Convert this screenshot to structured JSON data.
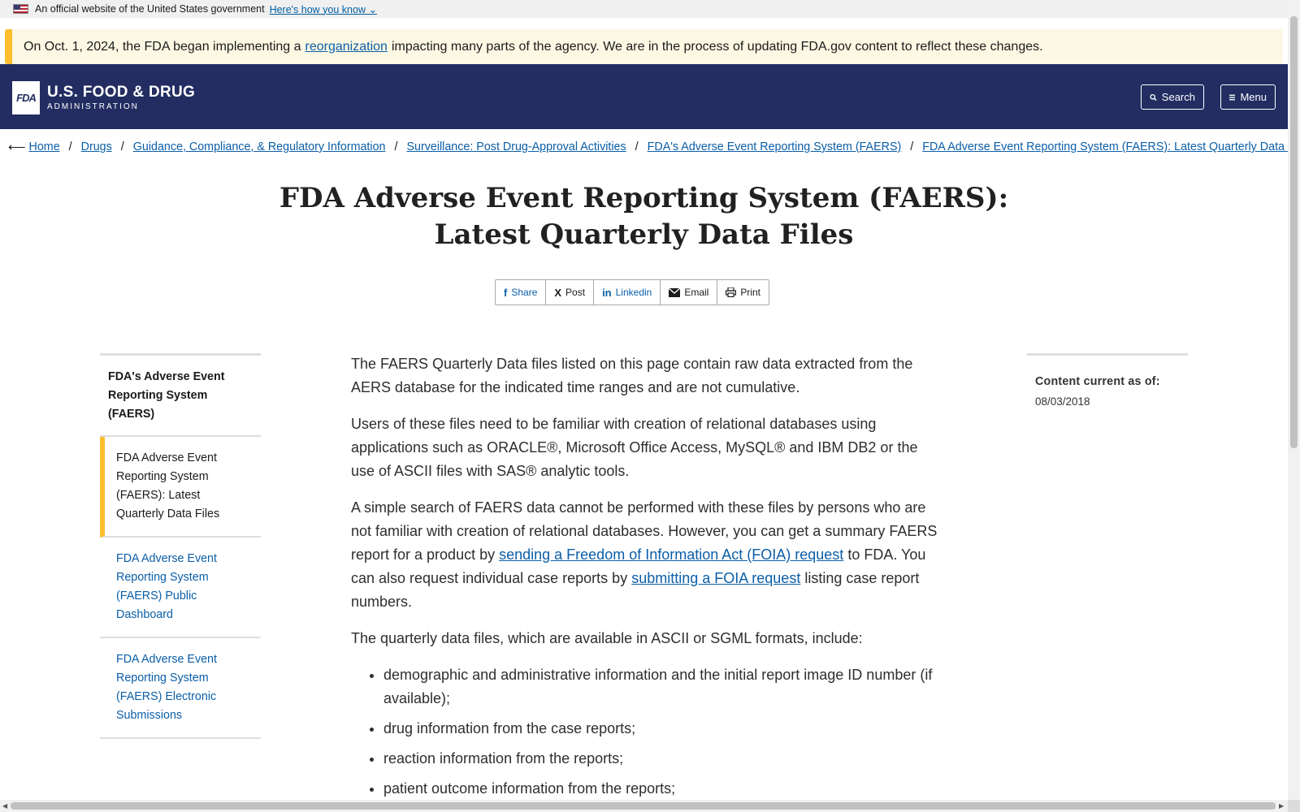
{
  "gov_banner": {
    "text": "An official website of the United States government",
    "link": "Here's how you know"
  },
  "alert": {
    "before": "On Oct. 1, 2024, the FDA began implementing a",
    "link": "reorganization",
    "after": "impacting many parts of the agency. We are in the process of updating FDA.gov content to reflect these changes."
  },
  "header": {
    "logo_box": "FDA",
    "logo_main": "U.S. FOOD & DRUG",
    "logo_sub": "ADMINISTRATION",
    "search_label": "Search",
    "menu_label": "Menu"
  },
  "breadcrumb": [
    "Home",
    "Drugs",
    "Guidance, Compliance, & Regulatory Information",
    "Surveillance: Post Drug-Approval Activities",
    "FDA's Adverse Event Reporting System (FAERS)",
    "FDA Adverse Event Reporting System (FAERS): Latest Quarterly Data Files"
  ],
  "title": {
    "line1": "FDA Adverse Event Reporting System (FAERS):",
    "line2": "Latest Quarterly Data Files"
  },
  "share": {
    "share": "Share",
    "post": "Post",
    "linkedin": "Linkedin",
    "email": "Email",
    "print": "Print"
  },
  "sidenav": {
    "heading": "FDA's Adverse Event Reporting System (FAERS)",
    "items": [
      "FDA Adverse Event Reporting System (FAERS): Latest Quarterly Data Files",
      "FDA Adverse Event Reporting System (FAERS) Public Dashboard",
      "FDA Adverse Event Reporting System (FAERS) Electronic Submissions"
    ]
  },
  "content": {
    "p1": "The FAERS Quarterly Data files listed on this page contain raw data extracted from the AERS database for the indicated time ranges and are not cumulative.",
    "p2": "Users of these files need to be familiar with creation of relational databases using applications such as ORACLE®, Microsoft Office Access, MySQL® and IBM DB2 or the use of ASCII files with SAS® analytic tools.",
    "p3_a": "A simple search of FAERS data cannot be performed with these files by persons who are not familiar with creation of relational databases. However, you can get a summary FAERS report for a product by",
    "p3_link1": "sending a Freedom of Information Act (FOIA) request",
    "p3_b": "to FDA. You can also request individual case reports by",
    "p3_link2": "submitting a FOIA request",
    "p3_c": "listing case report numbers.",
    "p4": "The quarterly data files, which are available in ASCII or SGML formats, include:",
    "list": [
      "demographic and administrative information and the initial report image ID number (if available);",
      "drug information from the case reports;",
      "reaction information from the reports;",
      "patient outcome information from the reports;"
    ]
  },
  "aside": {
    "label": "Content current as of:",
    "value": "08/03/2018"
  }
}
